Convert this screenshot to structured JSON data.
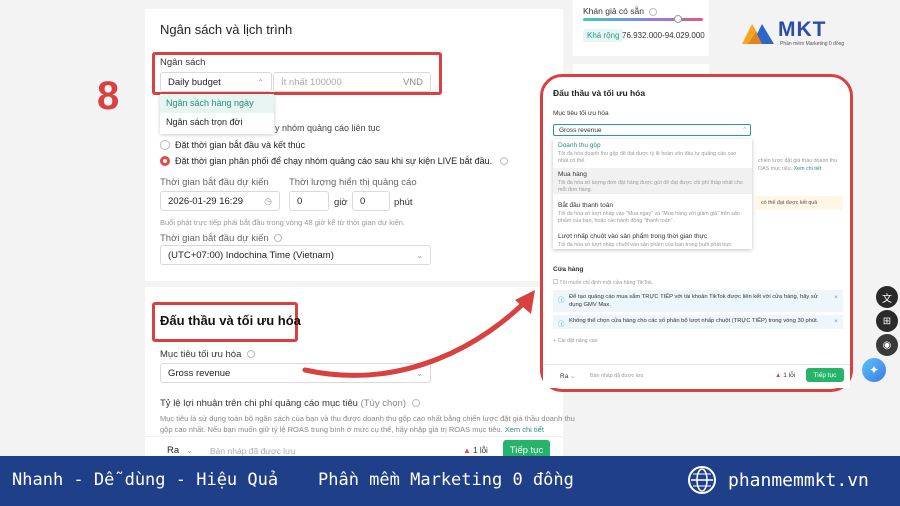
{
  "budget_section": {
    "title": "Ngân sách và lịch trình",
    "budget_label": "Ngân sách",
    "budget_select": "Daily budget",
    "budget_placeholder": "Ít nhất 100000",
    "currency": "VND",
    "options": [
      "Ngân sách hàng ngày",
      "Ngân sách trọn đời"
    ],
    "hidden_text": "y nhóm quảng cáo liên tục",
    "radio1": "Đặt thời gian bắt đầu và kết thúc",
    "radio2": "Đặt thời gian phân phối để chạy nhóm quảng cáo sau khi sự kiện LIVE bắt đầu.",
    "start_label": "Thời gian bắt đầu dự kiến",
    "start_value": "2026-01-29 16:29",
    "duration_label": "Thời lượng hiển thị quảng cáo",
    "hours_value": "0",
    "hours_unit": "giờ",
    "minutes_value": "0",
    "minutes_unit": "phút",
    "note": "Buổi phát trực tiếp phải bắt đầu trong vòng 48 giờ kể từ thời gian dự kiến.",
    "tz_label": "Thời gian bắt đầu dự kiến",
    "tz_value": "(UTC+07:00) Indochina Time (Vietnam)"
  },
  "bidding_section": {
    "title": "Đấu thầu và tối ưu hóa",
    "goal_label": "Mục tiêu tối ưu hóa",
    "goal_value": "Gross revenue",
    "roas_label": "Tỷ lệ lợi nhuận trên chi phí quảng cáo mục tiêu",
    "roas_optional": "(Tùy chọn)",
    "roas_desc1": "Mục tiêu là sử dụng toàn bộ ngân sách của bạn và thu được doanh thu gộp cao nhất bằng chiến lược đặt giá thầu doanh thu",
    "roas_desc2": "gộp cao nhất. Nếu bạn muốn giữ tỷ lệ ROAS trung bình ở mức cụ thể, hãy nhập giá trị ROAS mục tiêu.",
    "roas_link": "Xem chi tiết",
    "footer_select": "Ra",
    "draft_text": "Bản nháp đã được lưu",
    "error_count": "1 lỗi",
    "continue": "Tiếp tục"
  },
  "step_number": "8",
  "right_card": {
    "label": "Khán giả có sẵn",
    "chip": "Khá rộng",
    "range": "76.932.000-94.029.000"
  },
  "logo": {
    "name": "MKT",
    "tagline": "Phần mềm Marketing 0 đồng"
  },
  "zoom": {
    "title": "Đấu thầu và tối ưu hóa",
    "goal_label": "Mục tiêu tối ưu hóa",
    "goal_value": "Gross revenue",
    "items": [
      {
        "title": "Doanh thu gộp",
        "desc": "Tối đa hóa doanh thu gộp để đạt được tỷ lệ hoàn vốn đầu tư quảng cáo cao nhất có thể."
      },
      {
        "title": "Mua hàng",
        "desc": "Tối đa hóa số lượng đơn đặt hàng được gửi để đạt được chi phí thấp nhất cho mỗi đơn hàng."
      },
      {
        "title": "Bắt đầu thanh toán",
        "desc": "Tối đa hóa số lượt nhấp vào \"Mua ngay\" và \"Mua hàng với giảm giá\" trên sản phẩm của bạn, hoặc các hành động \"thanh toán\"."
      },
      {
        "title": "Lượt nhấp chuột vào sản phẩm trong thời gian thực",
        "desc": "Tối đa hóa số lượt nhấp chuột vào sản phẩm của bạn trong buổi phát trực tiếp."
      }
    ],
    "side_text1": "chiến lược đặt giá thầu doanh thu",
    "side_text2": "OAS mục tiêu.",
    "side_link": "Xem chi tiết",
    "side_warn": "có thể đạt được kết quả",
    "store_label": "Cửa hàng",
    "store_check": "Tôi muốn chỉ định một cửa hàng TikTok.",
    "notice1a": "Để tạo quảng cáo mua sắm TRỰC TIẾP với tài khoản TikTok được liên kết với cửa hàng, hãy sử",
    "notice1b": "dụng GMV Max.",
    "notice2": "Không thể chọn cửa hàng cho các số phân bổ lượt nhấp chuột (TRỰC TIẾP) trong vòng 30 phút.",
    "advanced": "Cài đặt nâng cao",
    "footer_select": "Ra",
    "draft_text": "Bản nháp đã được lưu",
    "error_count": "1 lỗi",
    "continue": "Tiếp tục"
  },
  "banner": {
    "slogan1": "Nhanh - Dễ dùng - Hiệu Quả",
    "slogan2": "Phần mềm Marketing 0 đồng",
    "website": "phanmemmkt.vn"
  },
  "colors": {
    "accent_red": "#d94040",
    "green": "#26b36a",
    "banner_blue": "#1f4089"
  }
}
